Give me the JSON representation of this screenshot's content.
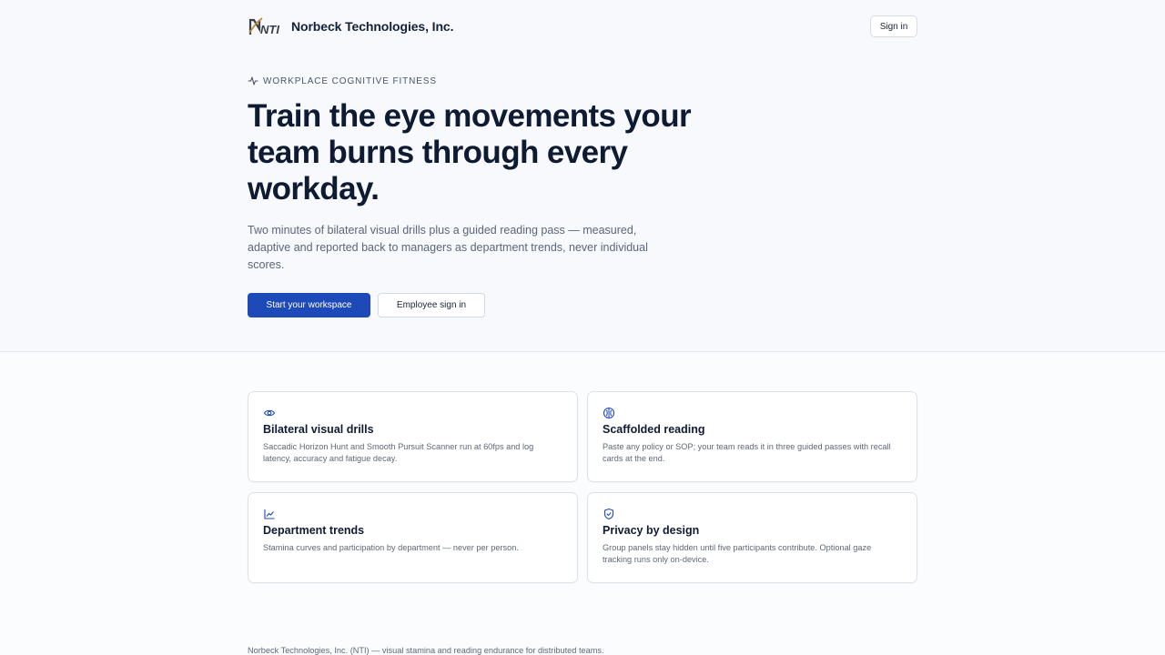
{
  "header": {
    "logo_text": "NTI",
    "brand_name": "Norbeck Technologies, Inc.",
    "signin_label": "Sign in"
  },
  "hero": {
    "eyebrow": "WORKPLACE COGNITIVE FITNESS",
    "headline": "Train the eye movements your team burns through every workday.",
    "subtext": "Two minutes of bilateral visual drills plus a guided reading pass — measured, adaptive and reported back to managers as department trends, never individual scores.",
    "primary_cta": "Start your workspace",
    "secondary_cta": "Employee sign in"
  },
  "features": [
    {
      "icon": "eye-icon",
      "title": "Bilateral visual drills",
      "desc": "Saccadic Horizon Hunt and Smooth Pursuit Scanner run at 60fps and log latency, accuracy and fatigue decay."
    },
    {
      "icon": "brain-icon",
      "title": "Scaffolded reading",
      "desc": "Paste any policy or SOP; your team reads it in three guided passes with recall cards at the end."
    },
    {
      "icon": "line-chart-icon",
      "title": "Department trends",
      "desc": "Stamina curves and participation by department — never per person."
    },
    {
      "icon": "shield-check-icon",
      "title": "Privacy by design",
      "desc": "Group panels stay hidden until five participants contribute. Optional gaze tracking runs only on-device."
    }
  ],
  "footer": {
    "text": "Norbeck Technologies, Inc. (NTI) — visual stamina and reading endurance for distributed teams."
  },
  "colors": {
    "accent": "#1d4ab8",
    "heading": "#0f1b33",
    "muted": "#5b6679",
    "background": "#f7f9fc"
  }
}
